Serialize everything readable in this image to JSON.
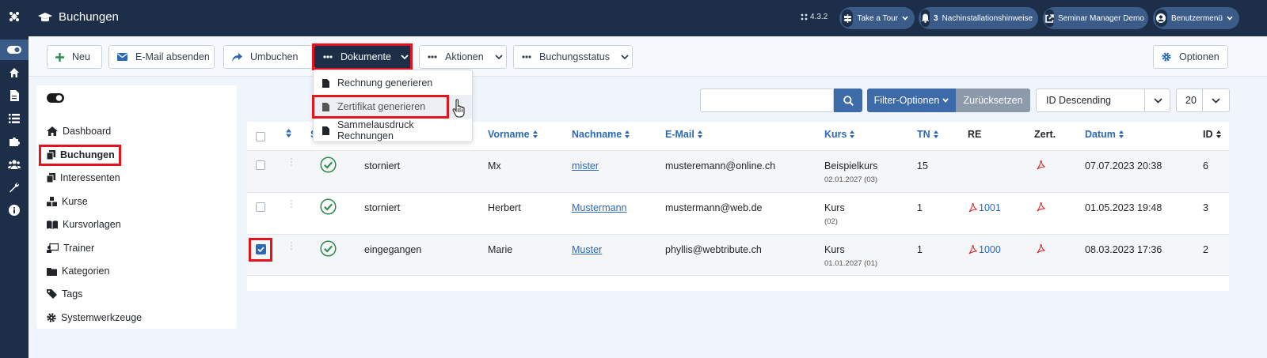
{
  "header": {
    "title": "Buchungen",
    "version": "4.3.2",
    "take_tour": "Take a Tour",
    "notification_count": "3",
    "post_install": "Nachinstallationshinweise",
    "site_link": "Seminar Manager Demo",
    "user_menu": "Benutzermenü"
  },
  "toolbar": {
    "new": "Neu",
    "email": "E-Mail absenden",
    "rebook": "Umbuchen",
    "documents": "Dokumente",
    "actions": "Aktionen",
    "booking_status": "Buchungsstatus",
    "options": "Optionen"
  },
  "documents_menu": {
    "items": [
      "Rechnung generieren",
      "Zertifikat generieren",
      "Sammelausdruck Rechnungen"
    ],
    "hovered": "Zertifikat generieren"
  },
  "sidebar": {
    "items": [
      "Dashboard",
      "Buchungen",
      "Interessenten",
      "Kurse",
      "Kursvorlagen",
      "Trainer",
      "Kategorien",
      "Tags",
      "Systemwerkzeuge"
    ],
    "active": "Buchungen"
  },
  "filters": {
    "search_value": "",
    "filter_options": "Filter-Optionen",
    "reset": "Zurücksetzen",
    "sort": "ID Descending",
    "limit": "20"
  },
  "table": {
    "headers": {
      "status_abbrev": "S",
      "firstname": "Vorname",
      "lastname": "Nachname",
      "email": "E-Mail",
      "course": "Kurs",
      "participants": "TN",
      "invoice": "RE",
      "certificate": "Zert.",
      "date": "Datum",
      "id": "ID"
    },
    "rows": [
      {
        "checked": false,
        "state": "storniert",
        "firstname": "Mx",
        "lastname": "mister",
        "email": "musteremann@online.ch",
        "course": "Beispielkurs",
        "course_sub": "02.01.2027 (03)",
        "participants": "15",
        "invoice": "",
        "date": "07.07.2023 20:38",
        "id": "6"
      },
      {
        "checked": false,
        "state": "storniert",
        "firstname": "Herbert",
        "lastname": "Mustermann",
        "email": "mustermann@web.de",
        "course": "Kurs",
        "course_sub": "(02)",
        "participants": "1",
        "invoice": "1001",
        "date": "01.05.2023 19:48",
        "id": "3"
      },
      {
        "checked": true,
        "state": "eingegangen",
        "firstname": "Marie",
        "lastname": "Muster",
        "email": "phyllis@webtribute.ch",
        "course": "Kurs",
        "course_sub": "01.01.2027 (01)",
        "participants": "1",
        "invoice": "1000",
        "date": "08.03.2023 17:36",
        "id": "2"
      }
    ]
  },
  "colors": {
    "navy": "#1c2e48",
    "pill": "#3b5b89",
    "primary": "#2a69b8",
    "filter_button": "#3d6aa8",
    "reset_button": "#8d9aab",
    "success": "#2c8a4f",
    "highlight": "#e5141c"
  }
}
